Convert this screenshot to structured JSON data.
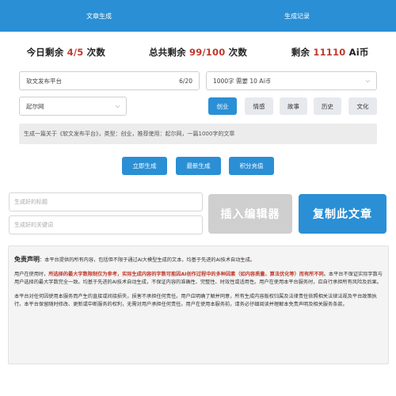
{
  "header": {
    "tabs": [
      {
        "label": "文章生成"
      },
      {
        "label": "生成记录"
      }
    ]
  },
  "stats": {
    "daily_label": "今日剩余",
    "daily_value": "4/5",
    "daily_unit": "次数",
    "total_label": "总共剩余",
    "total_value": "99/100",
    "total_unit": "次数",
    "balance_label": "剩余",
    "balance_value": "11110",
    "balance_unit": "Ai币"
  },
  "form": {
    "title_value": "软文发布平台",
    "title_count": "6/20",
    "wordcount_value": "1000字 需要 10 Ai币",
    "platform_value": "起尔网",
    "genres": [
      "创业",
      "情感",
      "故事",
      "历史",
      "文化"
    ],
    "summary": "生成一篇关于《软文发布平台》，类型：创业，推荐使用：起尔网，一篇1000字的文章"
  },
  "actions": {
    "generate_now": "立即生成",
    "latest_generate": "最新生成",
    "points_recharge": "积分充值"
  },
  "output": {
    "title_placeholder": "生成好的标题",
    "keywords_placeholder": "生成好的关键词",
    "insert_editor": "插入编辑器",
    "copy_article": "复制此文章"
  },
  "disclaimer": {
    "label": "免责声明",
    "p1": "：本平台提供的所有内容，包括但不限于通过AI大模型生成的文本，均基于先进的AI技术自动生成。",
    "p2_start": "用户在使用时，",
    "p2_red": "所选择的最大字数限制仅为参考，实际生成内容的字数可能因AI创作过程中的多种因素（如内容质量、算法优化等）而有所不同",
    "p2_end": "。本平台不保证实际字数与用户选择的最大字数完全一致。均基于先进的AI技术自动生成，不保证内容的准确性、完整性、时效性或适用性。用户在使用本平台服务时，应自行承担所有风险及后果。",
    "p3": "本平台对任何因使用本服务而产生的直接或间接损失，损害不承担任何责任。用户应明确了解并同意，所有生成内容版权归属及法律责任依照相关法律法规及平台政策执行。本平台保留随时修改、更新或中断服务的权利，无需对用户承担任何责任。用户在使用本服务前，请务必仔细阅读并理解本免责声明及相关服务条款。"
  },
  "colors": {
    "primary": "#2a8fd5",
    "accent_red": "#c0392b",
    "disabled": "#cfcfcf"
  }
}
